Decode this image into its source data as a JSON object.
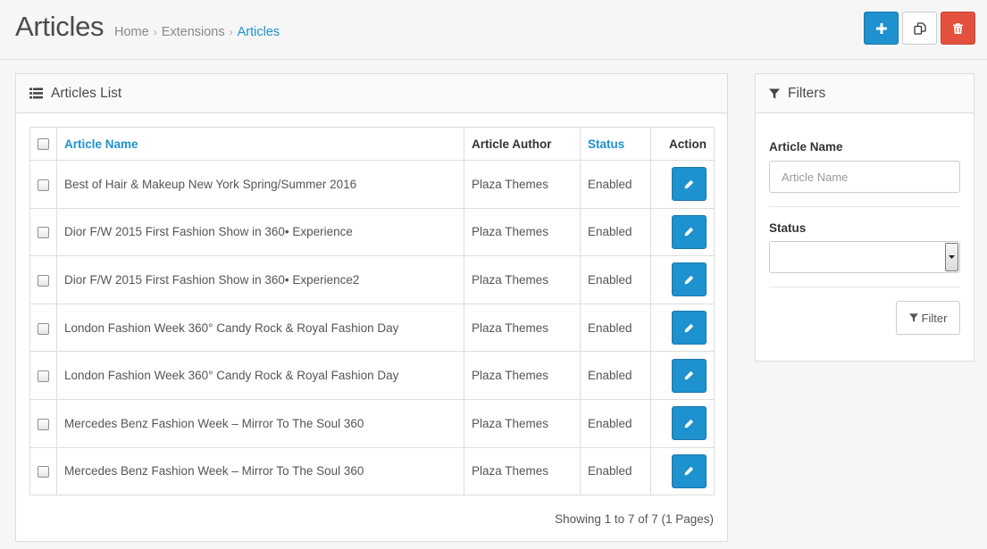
{
  "header": {
    "title": "Articles",
    "breadcrumb": [
      "Home",
      "Extensions",
      "Articles"
    ],
    "separator": "›",
    "actions": {
      "add_icon": "plus-icon",
      "copy_icon": "copy-icon",
      "delete_icon": "trash-icon"
    }
  },
  "list": {
    "heading": "Articles List",
    "heading_icon": "list-icon",
    "columns": {
      "name": "Article Name",
      "author": "Article Author",
      "status": "Status",
      "action": "Action"
    },
    "rows": [
      {
        "name": "Best of Hair & Makeup New York Spring/Summer 2016",
        "author": "Plaza Themes",
        "status": "Enabled"
      },
      {
        "name": "Dior F/W 2015 First Fashion Show in 360• Experience",
        "author": "Plaza Themes",
        "status": "Enabled"
      },
      {
        "name": "Dior F/W 2015 First Fashion Show in 360• Experience2",
        "author": "Plaza Themes",
        "status": "Enabled"
      },
      {
        "name": "London Fashion Week 360° Candy Rock & Royal Fashion Day",
        "author": "Plaza Themes",
        "status": "Enabled"
      },
      {
        "name": "London Fashion Week 360° Candy Rock & Royal Fashion Day",
        "author": "Plaza Themes",
        "status": "Enabled"
      },
      {
        "name": "Mercedes Benz Fashion Week – Mirror To The Soul 360",
        "author": "Plaza Themes",
        "status": "Enabled"
      },
      {
        "name": "Mercedes Benz Fashion Week – Mirror To The Soul 360",
        "author": "Plaza Themes",
        "status": "Enabled"
      }
    ],
    "pagination": "Showing 1 to 7 of 7 (1 Pages)"
  },
  "filters": {
    "heading": "Filters",
    "heading_icon": "filter-icon",
    "name_label": "Article Name",
    "name_placeholder": "Article Name",
    "name_value": "",
    "status_label": "Status",
    "status_value": "",
    "button_label": "Filter"
  },
  "colors": {
    "primary": "#1e91cf",
    "danger": "#e3503e"
  }
}
